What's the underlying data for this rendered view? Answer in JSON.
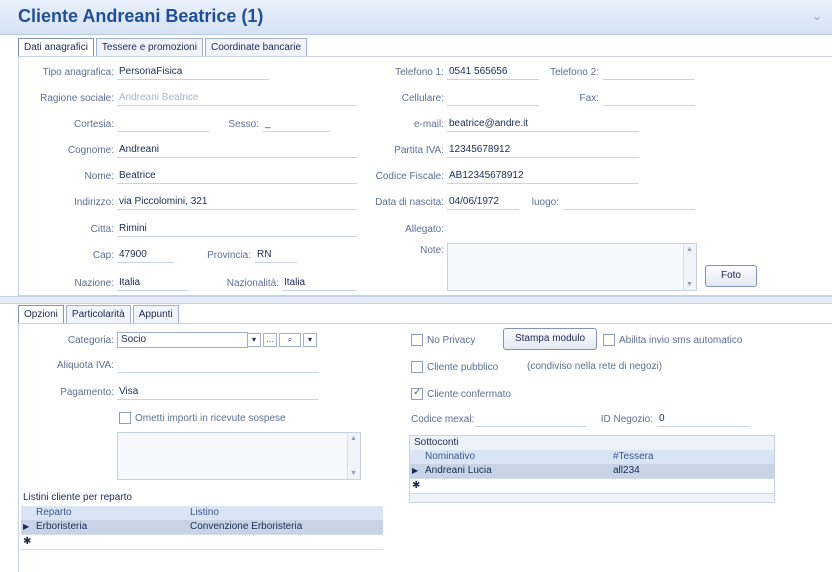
{
  "window": {
    "title": "Cliente Andreani Beatrice (1)"
  },
  "top_tabs": [
    "Dati anagrafici",
    "Tessere e promozioni",
    "Coordinate bancarie"
  ],
  "anagrafica": {
    "tipo_label": "Tipo anagrafica:",
    "tipo": "PersonaFisica",
    "ragione_label": "Ragione sociale:",
    "ragione": "Andreani Beatrice",
    "cortesia_label": "Cortesia:",
    "cortesia": "",
    "sesso_label": "Sesso:",
    "sesso": "_",
    "cognome_label": "Cognome:",
    "cognome": "Andreani",
    "nome_label": "Nome:",
    "nome": "Beatrice",
    "indirizzo_label": "Indirizzo:",
    "indirizzo": "via Piccolomini, 321",
    "citta_label": "Citta:",
    "citta": "Rimini",
    "cap_label": "Cap:",
    "cap": "47900",
    "provincia_label": "Provincia:",
    "provincia": "RN",
    "nazione_label": "Nazione:",
    "nazione": "Italia",
    "nazionalita_label": "Nazionalità:",
    "nazionalita": "Italia",
    "telefono1_label": "Telefono 1:",
    "telefono1": "0541 565656",
    "telefono2_label": "Telefono 2:",
    "telefono2": "",
    "cellulare_label": "Cellulare:",
    "cellulare": "",
    "fax_label": "Fax:",
    "fax": "",
    "email_label": "e-mail:",
    "email": "beatrice@andre.it",
    "piva_label": "Partita IVA:",
    "piva": "12345678912",
    "cf_label": "Codice Fiscale:",
    "cf": "AB12345678912",
    "nascita_label": "Data di nascita:",
    "nascita": "04/06/1972",
    "luogo_label": "luogo:",
    "luogo": "",
    "allegato_label": "Allegato:",
    "note_label": "Note:",
    "foto_button": "Foto"
  },
  "bottom_tabs": [
    "Opzioni",
    "Particolarità",
    "Appunti"
  ],
  "opzioni": {
    "categoria_label": "Categoria:",
    "categoria": "Socio",
    "aliquota_label": "Aliquota IVA:",
    "aliquota": "",
    "pagamento_label": "Pagamento:",
    "pagamento": "Visa",
    "ometti_label": "Ometti importi in ricevute sospese",
    "no_privacy_label": "No Privacy",
    "stampa_button": "Stampa modulo",
    "abilita_sms_label": "Abilita invio sms automatico",
    "cliente_pubblico_label": "Cliente pubblico",
    "condiviso_text": "(condiviso nella rete di negozi)",
    "cliente_confermato_label": "Cliente confermato",
    "codice_mexal_label": "Codice mexal:",
    "id_negozio_label": "ID Negozio:",
    "id_negozio": "0"
  },
  "sottoconti": {
    "title": "Sottoconti",
    "headers": [
      "Nominativo",
      "#Tessera"
    ],
    "rows": [
      [
        "Andreani Lucia",
        "all234"
      ]
    ]
  },
  "listini": {
    "title": "Listini cliente per reparto",
    "headers": [
      "Reparto",
      "Listino"
    ],
    "rows": [
      [
        "Erboristeria",
        "Convenzione Erboristeria"
      ]
    ]
  }
}
